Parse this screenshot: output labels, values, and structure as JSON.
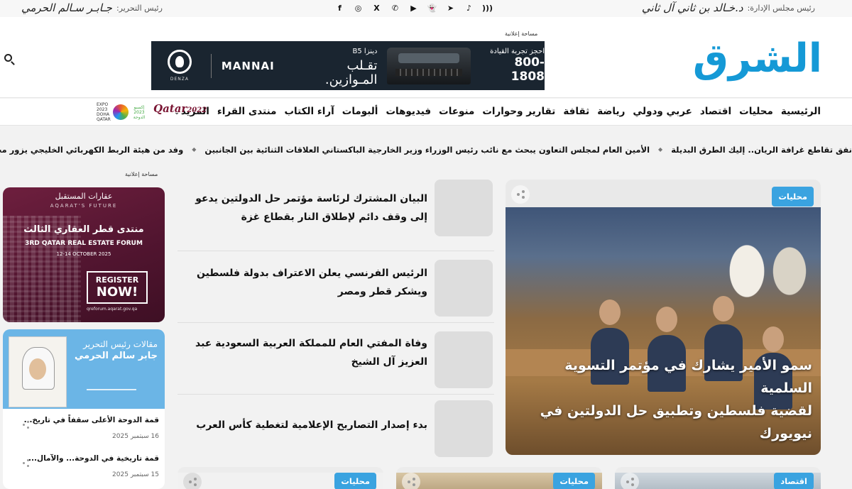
{
  "topbar": {
    "chair_label": "رئيس مجلس الإدارة:",
    "chair_name": "د.خـالد بن ثاني آل ثاني",
    "editor_label": "رئيس التحرير:",
    "editor_name": "جـابـر سـالم الحرمي",
    "socials": [
      "facebook-icon",
      "instagram-icon",
      "x-icon",
      "youtube-icon",
      "whatsapp-icon",
      "snapchat-icon",
      "telegram-icon",
      "tiktok-icon",
      "rss-icon"
    ]
  },
  "header": {
    "logo": "الشرق",
    "ad_label": "مساحة إعلانية",
    "ad": {
      "brand": "DENZA",
      "dealer": "MANNAI",
      "model": "دينزا B5",
      "slogan_1": "تقـلب",
      "slogan_2": "المـوازين.",
      "cta": "احجز تجربة القيادة",
      "phone": "800-1808"
    }
  },
  "nav": {
    "items": [
      "الرئيسية",
      "محليات",
      "اقتصاد",
      "عربي ودولي",
      "رياضة",
      "ثقافة",
      "تقارير وحوارات",
      "منوعات",
      "فيديوهات",
      "ألبومات",
      "آراء الكتاب",
      "منتدى القراء"
    ],
    "more": "المزيد",
    "qatar_logo": "Qatar",
    "qatar_year": "2022",
    "expo_text": "EXPO 2023 DOHA QATAR",
    "expo_ar": "إكسبو 2023 الدوحة"
  },
  "ticker": {
    "items": [
      "نفق تقاطع غرافة الريان.. إليك الطرق البديلة",
      "الأمين العام لمجلس التعاون يبحث مع نائب رئيس الوزراء وزير الخارجية الباكستاني العلاقات الثنائية بين الجانبين",
      "وفد من هيئة الربط الكهربائي الخليجي يزور محطة الخرسعة للطاقة الشمسية"
    ]
  },
  "feature": {
    "tag": "محليات",
    "headline_1": "سمو الأمير يشارك في مؤتمر التسوية السلمية",
    "headline_2": "لقضية فلسطين وتطبيق حل الدولتين في نيويورك"
  },
  "list": [
    {
      "title": "البيان المشترك لرئاسة مؤتمر حل الدولتين يدعو إلى وقف دائم لإطلاق النار بقطاع غزة"
    },
    {
      "title": "الرئيس الفرنسي يعلن الاعتراف بدولة فلسطين ويشكر قطر ومصر"
    },
    {
      "title": "وفاة المفتي العام للمملكة العربية السعودية عبد العزيز آل الشيخ"
    },
    {
      "title": "بدء إصدار التصاريح الإعلامية لتغطية كأس العرب"
    }
  ],
  "sidebar": {
    "ad_label": "مساحة إعلانية",
    "forum_ad": {
      "org": "عقارات المستقبل",
      "org_en": "AQARAT'S FUTURE",
      "title_ar": "منتدى قطر العقاري الثالث",
      "title_en": "3RD QATAR REAL ESTATE FORUM",
      "date": "12-14 OCTOBER 2025",
      "register_1": "REGISTER",
      "register_2": "NOW!",
      "url": "qreforum.aqarat.gov.qa"
    },
    "editor_articles": {
      "label": "مقالات رئيس التحرير",
      "name": "جابر سالم الحرمي",
      "articles": [
        {
          "title": "قمة الدوحة الأعلى سقفاً في تاريخ...",
          "date": "16 سبتمبر 2025"
        },
        {
          "title": "قمة تاريخية في الدوحة... والآمال...",
          "date": "15 سبتمبر 2025"
        }
      ]
    }
  },
  "bottom_cards": [
    {
      "tag": "اقتصاد"
    },
    {
      "tag": "محليات"
    },
    {
      "tag": "محليات"
    }
  ]
}
